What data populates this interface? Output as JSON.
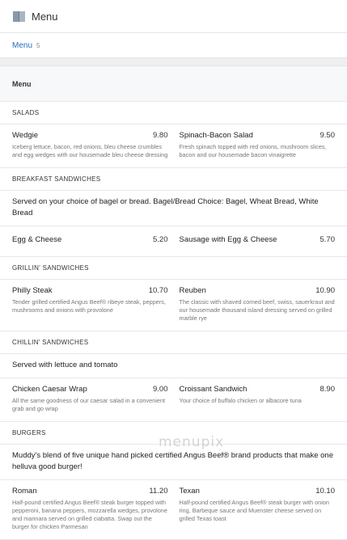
{
  "header": {
    "title": "Menu",
    "icon": "book-icon"
  },
  "breadcrumb": {
    "link": "Menu",
    "count": "5"
  },
  "menu": {
    "title": "Menu",
    "sections": [
      {
        "id": "salads",
        "name": "SALADS",
        "note": "",
        "items": [
          {
            "name": "Wedgie",
            "price": "9.80",
            "desc": "Iceberg lettuce, bacon, red onions, bleu cheese crumbles and egg wedges with our housemade bleu cheese dressing"
          },
          {
            "name": "Spinach-Bacon Salad",
            "price": "9.50",
            "desc": "Fresh spinach topped with red onions, mushroom slices, bacon and our housemade bacon vinaigrette"
          }
        ]
      },
      {
        "id": "breakfast",
        "name": "BREAKFAST SANDWICHES",
        "note": "Served on your choice of bagel or bread. Bagel/Bread Choice: Bagel, Wheat Bread, White Bread",
        "items": [
          {
            "name": "Egg & Cheese",
            "price": "5.20",
            "desc": ""
          },
          {
            "name": "Sausage with Egg & Cheese",
            "price": "5.70",
            "desc": ""
          }
        ]
      },
      {
        "id": "grillin",
        "name": "GRILLIN' SANDWICHES",
        "note": "",
        "items": [
          {
            "name": "Philly Steak",
            "price": "10.70",
            "desc": "Tender grilled certified Angus Beef® ribeye steak, peppers, mushrooms and onions with provolone"
          },
          {
            "name": "Reuben",
            "price": "10.90",
            "desc": "The classic with shaved corned beef, swiss, sauerkraut and our housemade thousand island dressing served on grilled marble rye"
          }
        ]
      },
      {
        "id": "chillin",
        "name": "CHILLIN' SANDWICHES",
        "note": "Served with lettuce and tomato",
        "items": [
          {
            "name": "Chicken Caesar Wrap",
            "price": "9.00",
            "desc": "All the same goodness of our caesar salad in a convenient grab and go wrap"
          },
          {
            "name": "Croissant Sandwich",
            "price": "8.90",
            "desc": "Your choice of buffalo chicken or albacore tuna"
          }
        ]
      },
      {
        "id": "burgers",
        "name": "BURGERS",
        "note": "Muddy's blend of five unique hand picked certified Angus Beef® brand products that make one helluva good burger!",
        "items": [
          {
            "name": "Roman",
            "price": "11.20",
            "desc": "Half-pound certified Angus Beef® steak burger topped with pepperoni, banana peppers, mozzarella wedges, provolone and marinara served on grilled ciabatta. Swap out the burger for chicken Parmesan"
          },
          {
            "name": "Texan",
            "price": "10.10",
            "desc": "Half-pound certified Angus Beef® steak burger with onion ring, Barbeque sauce and Muenster cheese served on grilled Texas toast"
          }
        ]
      }
    ]
  },
  "watermark": "menupix"
}
